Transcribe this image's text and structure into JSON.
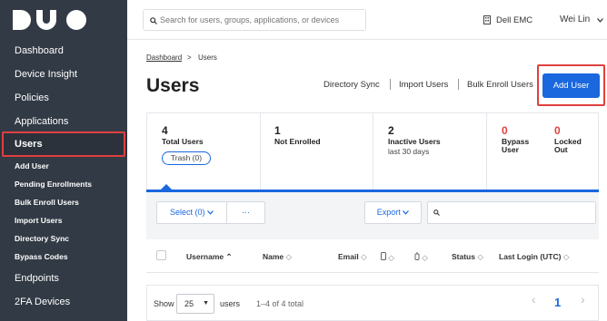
{
  "sidebar": {
    "logo": "DUO",
    "items": [
      {
        "label": "Dashboard"
      },
      {
        "label": "Device Insight"
      },
      {
        "label": "Policies"
      },
      {
        "label": "Applications"
      },
      {
        "label": "Users"
      }
    ],
    "users_submenu": [
      {
        "label": "Add User"
      },
      {
        "label": "Pending Enrollments"
      },
      {
        "label": "Bulk Enroll Users"
      },
      {
        "label": "Import Users"
      },
      {
        "label": "Directory Sync"
      },
      {
        "label": "Bypass Codes"
      }
    ],
    "bottom_items": [
      {
        "label": "Endpoints"
      },
      {
        "label": "2FA Devices"
      }
    ]
  },
  "header": {
    "search_placeholder": "Search for users, groups, applications, or devices",
    "org_name": "Dell EMC",
    "user_name": "Wei Lin"
  },
  "breadcrumb": {
    "parent": "Dashboard",
    "separator": ">",
    "current": "Users"
  },
  "page_title": "Users",
  "actions": {
    "directory_sync": "Directory Sync",
    "import_users": "Import Users",
    "bulk_enroll": "Bulk Enroll Users",
    "add_user": "Add User"
  },
  "stats": {
    "total": {
      "value": "4",
      "label": "Total Users",
      "trash": "Trash (0)"
    },
    "not_enrolled": {
      "value": "1",
      "label": "Not Enrolled"
    },
    "inactive": {
      "value": "2",
      "label": "Inactive Users",
      "sub": "last 30 days"
    },
    "bypass": {
      "value": "0",
      "label1": "Bypass",
      "label2": "User"
    },
    "locked": {
      "value": "0",
      "label1": "Locked",
      "label2": "Out"
    }
  },
  "toolbar": {
    "select_label": "Select (0)",
    "more_label": "···",
    "export_label": "Export"
  },
  "table": {
    "columns": [
      "Username",
      "Name",
      "Email",
      "Status",
      "Last Login (UTC)"
    ]
  },
  "footer": {
    "show_label": "Show",
    "page_size": "25",
    "users_label": "users",
    "range": "1–4 of 4 total",
    "current_page": "1"
  },
  "colors": {
    "sidebar_bg": "#323a45",
    "accent": "#1a67de",
    "highlight": "#e0403e"
  }
}
